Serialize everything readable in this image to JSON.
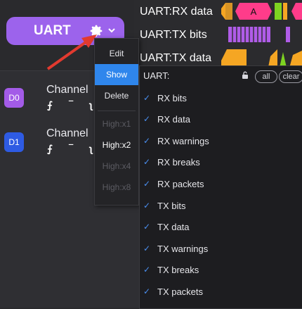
{
  "decoder": {
    "name": "UART"
  },
  "channels": [
    {
      "badge": "D0",
      "label": "Channel",
      "edges": "⨍ ‾ ʅ"
    },
    {
      "badge": "D1",
      "label": "Channel",
      "edges": "⨍ ‾ ʅ"
    }
  ],
  "context_menu": {
    "items": [
      "Edit",
      "Show",
      "Delete"
    ],
    "active": "Show",
    "heights": [
      "High:x1",
      "High:x2",
      "High:x4",
      "High:x8"
    ],
    "selected_height": "High:x2"
  },
  "rows": [
    "UART:RX data",
    "UART:TX bits",
    "UART:TX data"
  ],
  "wave": {
    "rx_data_text": "A",
    "colors": {
      "rx": "#ff3c8a",
      "bits": "#b05ce8",
      "tx": "#f5a623",
      "lime": "#7ed321"
    }
  },
  "dropdown": {
    "title": "UART:",
    "all_label": "all",
    "clear_label": "clear",
    "options": [
      "RX bits",
      "RX data",
      "RX warnings",
      "RX breaks",
      "RX packets",
      "TX bits",
      "TX data",
      "TX warnings",
      "TX breaks",
      "TX packets"
    ]
  },
  "colors": {
    "accent": "#2f86ec",
    "uart_pill": "#9c63ec",
    "d0": "#a35be8",
    "d1": "#2e5be3",
    "arrow": "#e23a2f"
  }
}
